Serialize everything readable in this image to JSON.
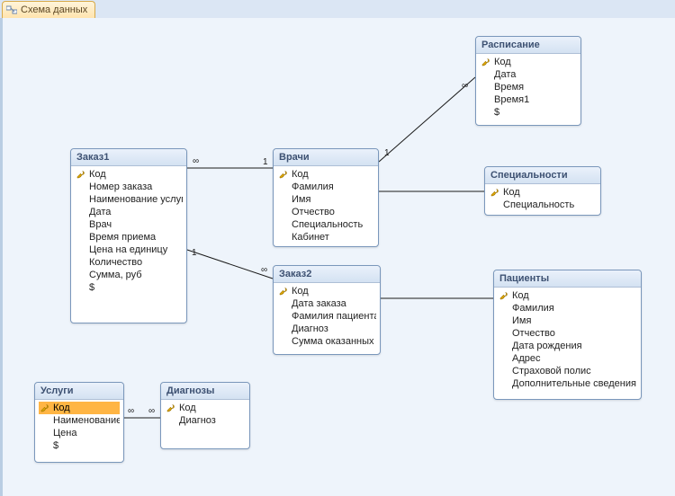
{
  "tab": {
    "title": "Схема данных"
  },
  "tables": {
    "zakaz1": {
      "title": "Заказ1",
      "fields": [
        "Код",
        "Номер заказа",
        "Наименование услуг",
        "Дата",
        "Врач",
        "Время приема",
        "Цена на единицу",
        "Количество",
        "Сумма, руб",
        "$"
      ],
      "pk_index": 0
    },
    "vrachi": {
      "title": "Врачи",
      "fields": [
        "Код",
        "Фамилия",
        "Имя",
        "Отчество",
        "Специальность",
        "Кабинет"
      ],
      "pk_index": 0
    },
    "raspisanie": {
      "title": "Расписание",
      "fields": [
        "Код",
        "Дата",
        "Время",
        "Время1",
        "$"
      ],
      "pk_index": 0
    },
    "spetsialnosti": {
      "title": "Специальности",
      "fields": [
        "Код",
        "Специальность"
      ],
      "pk_index": 0
    },
    "zakaz2": {
      "title": "Заказ2",
      "fields": [
        "Код",
        "Дата заказа",
        "Фамилия пациента",
        "Диагноз",
        "Сумма оказанных"
      ],
      "pk_index": 0
    },
    "patsienty": {
      "title": "Пациенты",
      "fields": [
        "Код",
        "Фамилия",
        "Имя",
        "Отчество",
        "Дата рождения",
        "Адрес",
        "Страховой полис",
        "Дополнительные сведения"
      ],
      "pk_index": 0
    },
    "uslugi": {
      "title": "Услуги",
      "fields": [
        "Код",
        "Наименование",
        "Цена",
        "$"
      ],
      "pk_index": 0,
      "selected_index": 0
    },
    "diagnozy": {
      "title": "Диагнозы",
      "fields": [
        "Код",
        "Диагноз"
      ],
      "pk_index": 0
    }
  },
  "relationships": [
    {
      "from": "zakaz1",
      "to": "vrachi",
      "from_card": "∞",
      "to_card": "1"
    },
    {
      "from": "zakaz1",
      "to": "zakaz2",
      "from_card": "1",
      "to_card": "∞"
    },
    {
      "from": "vrachi",
      "to": "raspisanie",
      "from_card": "1",
      "to_card": "∞"
    },
    {
      "from": "vrachi",
      "to": "spetsialnosti",
      "from_card": "",
      "to_card": ""
    },
    {
      "from": "zakaz2",
      "to": "patsienty",
      "from_card": "",
      "to_card": ""
    },
    {
      "from": "uslugi",
      "to": "diagnozy",
      "from_card": "∞",
      "to_card": "∞"
    }
  ],
  "labels": {
    "inf": "∞",
    "one": "1"
  }
}
